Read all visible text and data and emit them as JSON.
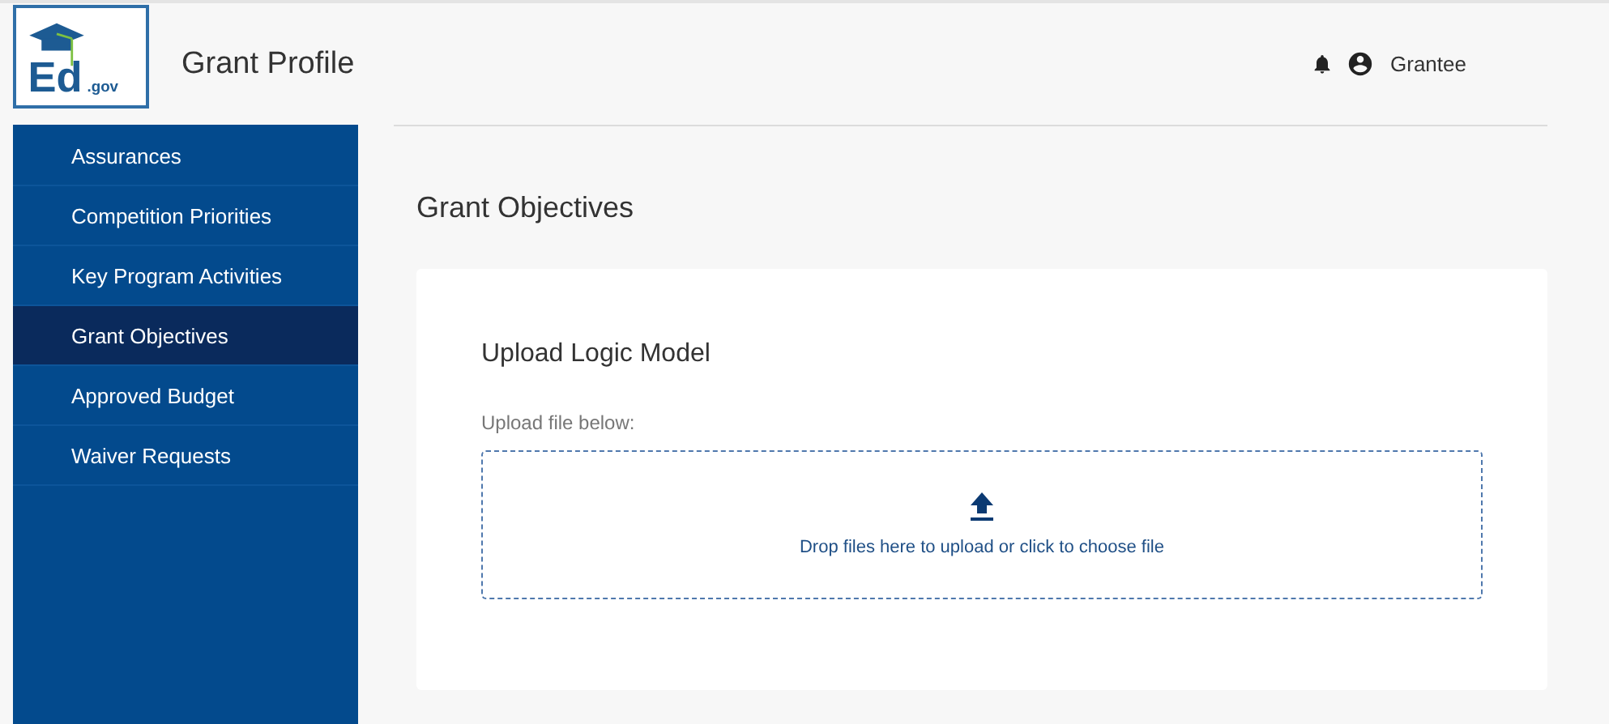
{
  "logo": {
    "mark": "Ed",
    "suffix": ".gov"
  },
  "header": {
    "title": "Grant Profile",
    "user": "Grantee"
  },
  "sidebar": {
    "items": [
      {
        "label": "Assurances",
        "selected": false
      },
      {
        "label": "Competition Priorities",
        "selected": false
      },
      {
        "label": "Key Program Activities",
        "selected": false
      },
      {
        "label": "Grant Objectives",
        "selected": true
      },
      {
        "label": "Approved Budget",
        "selected": false
      },
      {
        "label": "Waiver Requests",
        "selected": false
      }
    ]
  },
  "page": {
    "title": "Grant Objectives",
    "card": {
      "title": "Upload Logic Model",
      "label": "Upload file below:",
      "dropzone": "Drop files here to upload or click to choose file"
    }
  }
}
